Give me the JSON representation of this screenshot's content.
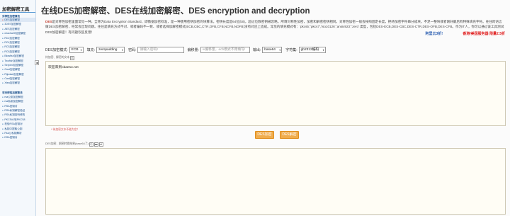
{
  "page_title": "在线DES加密解密、DES在线加密解密、DES encryption and decryption",
  "sidebar": {
    "title": "加密解密工具",
    "sections": [
      {
        "title": "对称性加密算法",
        "items": [
          "DES加密解密",
          "3DES加密解密",
          "AES加密解密",
          "chacha20加密解密",
          "RC2加密解密",
          "RC4加密解密",
          "RC5加密解密",
          "RC6加密解密",
          "Blowfish加密解密",
          "Twofish加密解密",
          "Serpent加密解密",
          "Gost加密解密",
          "Rijndael加密解密",
          "Cast加密解密",
          "Xtea加密解密"
        ]
      },
      {
        "title": "非对称性加密算法",
        "items": [
          "rsa公钥加密解密",
          "rsa私钥加密解密",
          "RSA密钥对",
          "RSA私钥解密验证",
          "RSA私钥密码修改",
          "PKCS#1转PKCS8",
          "校验RSA密钥对",
          "私钥中提取公钥",
          "Rsa公私钥解析",
          "DSA密钥对"
        ]
      }
    ],
    "toggle_icon": "collapse-arrow-icon"
  },
  "description": {
    "lead": "DES",
    "text": "是对称性加密里面常见一种，全称为Data Encryption Standard，即数据加密标准，是一种使用密钥加密的块算法。密钥长度是64位(bit)，超过位数密钥被忽略。所谓对称性加密，加密和解密密钥相同。对称性加密一般会按照固定长度，把待加密字符串分成块。不足一整块或者刚好最后有特殊填充字符。往往跨语言做DES加密解密，经常会出现问题。往往是填充方式不对、或者编码不一致、或者选择加解密模式(ECB,CBC,CTR,OFB,CFB,NCFB,NOFB)没有对应上造成。常见的填充模式有：'pkcs5','pkcs7','iso10126','ansix923','zero' 类型，包括DES-ECB,DES-CBC,DES-CTR,DES-OFB,DES-CFB。作为IT人，你可以通过该工具测试DES加密解密！有问题欢迎反馈！"
  },
  "promos": {
    "cloud": "阿里云3折!",
    "server": "香港/美国服务器 限量2.5折"
  },
  "controls": {
    "mode_label": "DES加密模式:",
    "mode_value": "ECB",
    "padding_label": "填充:",
    "padding_value": "zeropadding",
    "key_label": "密码:",
    "key_placeholder": "请输入密码!",
    "iv_label": "偏移量:",
    "iv_placeholder": "iv偏移量，ecb模式不用填写!",
    "output_label": "输出:",
    "output_value": "base64",
    "charset_label": "字符集:",
    "charset_value": "gb2312编码"
  },
  "input_area": {
    "label": "待加密、解密的文本",
    "value": "欢迎来到cbaeso.net",
    "warning": "* 待加密文本不能为空！"
  },
  "buttons": {
    "encrypt": "DES加密",
    "decrypt": "DES解密"
  },
  "output_area": {
    "label": "DES加密、解密转换结果(base64了)",
    "value": ""
  }
}
